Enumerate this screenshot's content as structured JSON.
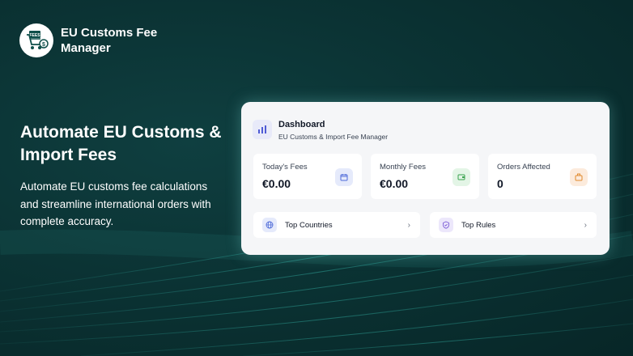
{
  "brand": {
    "name": "EU Customs Fee Manager",
    "logo_text": "FEES",
    "logo_icon": "cart-dollar-icon"
  },
  "hero": {
    "headline": "Automate EU Customs & Import Fees",
    "subtext": "Automate EU customs fee calculations and streamline international orders with complete accuracy."
  },
  "dashboard": {
    "title": "Dashboard",
    "subtitle": "EU Customs & Import Fee Manager",
    "stats": [
      {
        "label": "Today's Fees",
        "value": "€0.00",
        "icon": "calendar-icon",
        "color": "#4f6bd8"
      },
      {
        "label": "Monthly Fees",
        "value": "€0.00",
        "icon": "wallet-icon",
        "color": "#3aa34f"
      },
      {
        "label": "Orders Affected",
        "value": "0",
        "icon": "briefcase-icon",
        "color": "#e08a2c"
      }
    ],
    "links": [
      {
        "label": "Top Countries",
        "icon": "globe-icon"
      },
      {
        "label": "Top Rules",
        "icon": "shield-icon"
      }
    ]
  },
  "colors": {
    "background": "#0b3334",
    "accent_teal": "#1aa9a0",
    "card": "#f5f6f8"
  }
}
